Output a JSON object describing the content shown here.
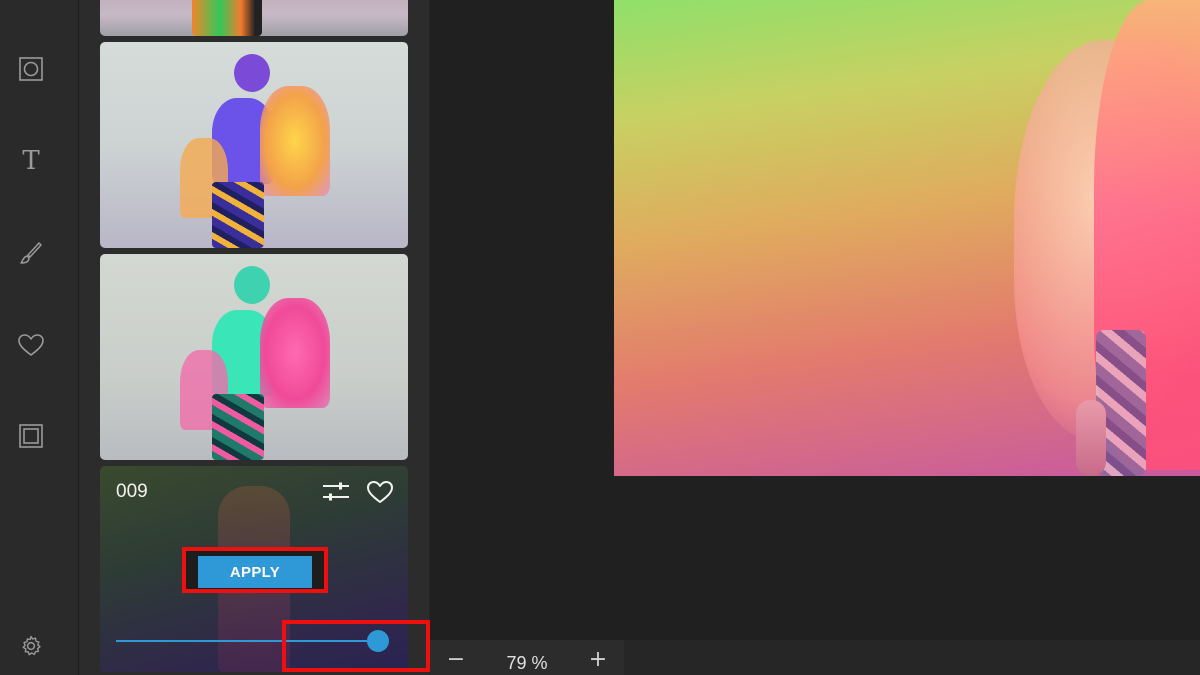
{
  "rail": {
    "tools": [
      {
        "name": "frame-tool",
        "icon": "square-circle-icon"
      },
      {
        "name": "text-tool",
        "icon": "text-icon",
        "glyph": "T"
      },
      {
        "name": "draw-tool",
        "icon": "brush-icon"
      },
      {
        "name": "favorites-tool",
        "icon": "heart-icon"
      },
      {
        "name": "border-tool",
        "icon": "border-frame-icon"
      },
      {
        "name": "settings-tool",
        "icon": "gear-icon"
      }
    ]
  },
  "filter_panel": {
    "active_filter": {
      "name": "009",
      "apply_label": "APPLY",
      "intensity_percent": 100
    }
  },
  "zoom": {
    "minus": "−",
    "value": "79 %",
    "plus": "+"
  },
  "colors": {
    "accent": "#2f98d6",
    "highlight": "#ee0f0f",
    "panel": "#2c2c2c",
    "rail": "#2a2a2a"
  }
}
